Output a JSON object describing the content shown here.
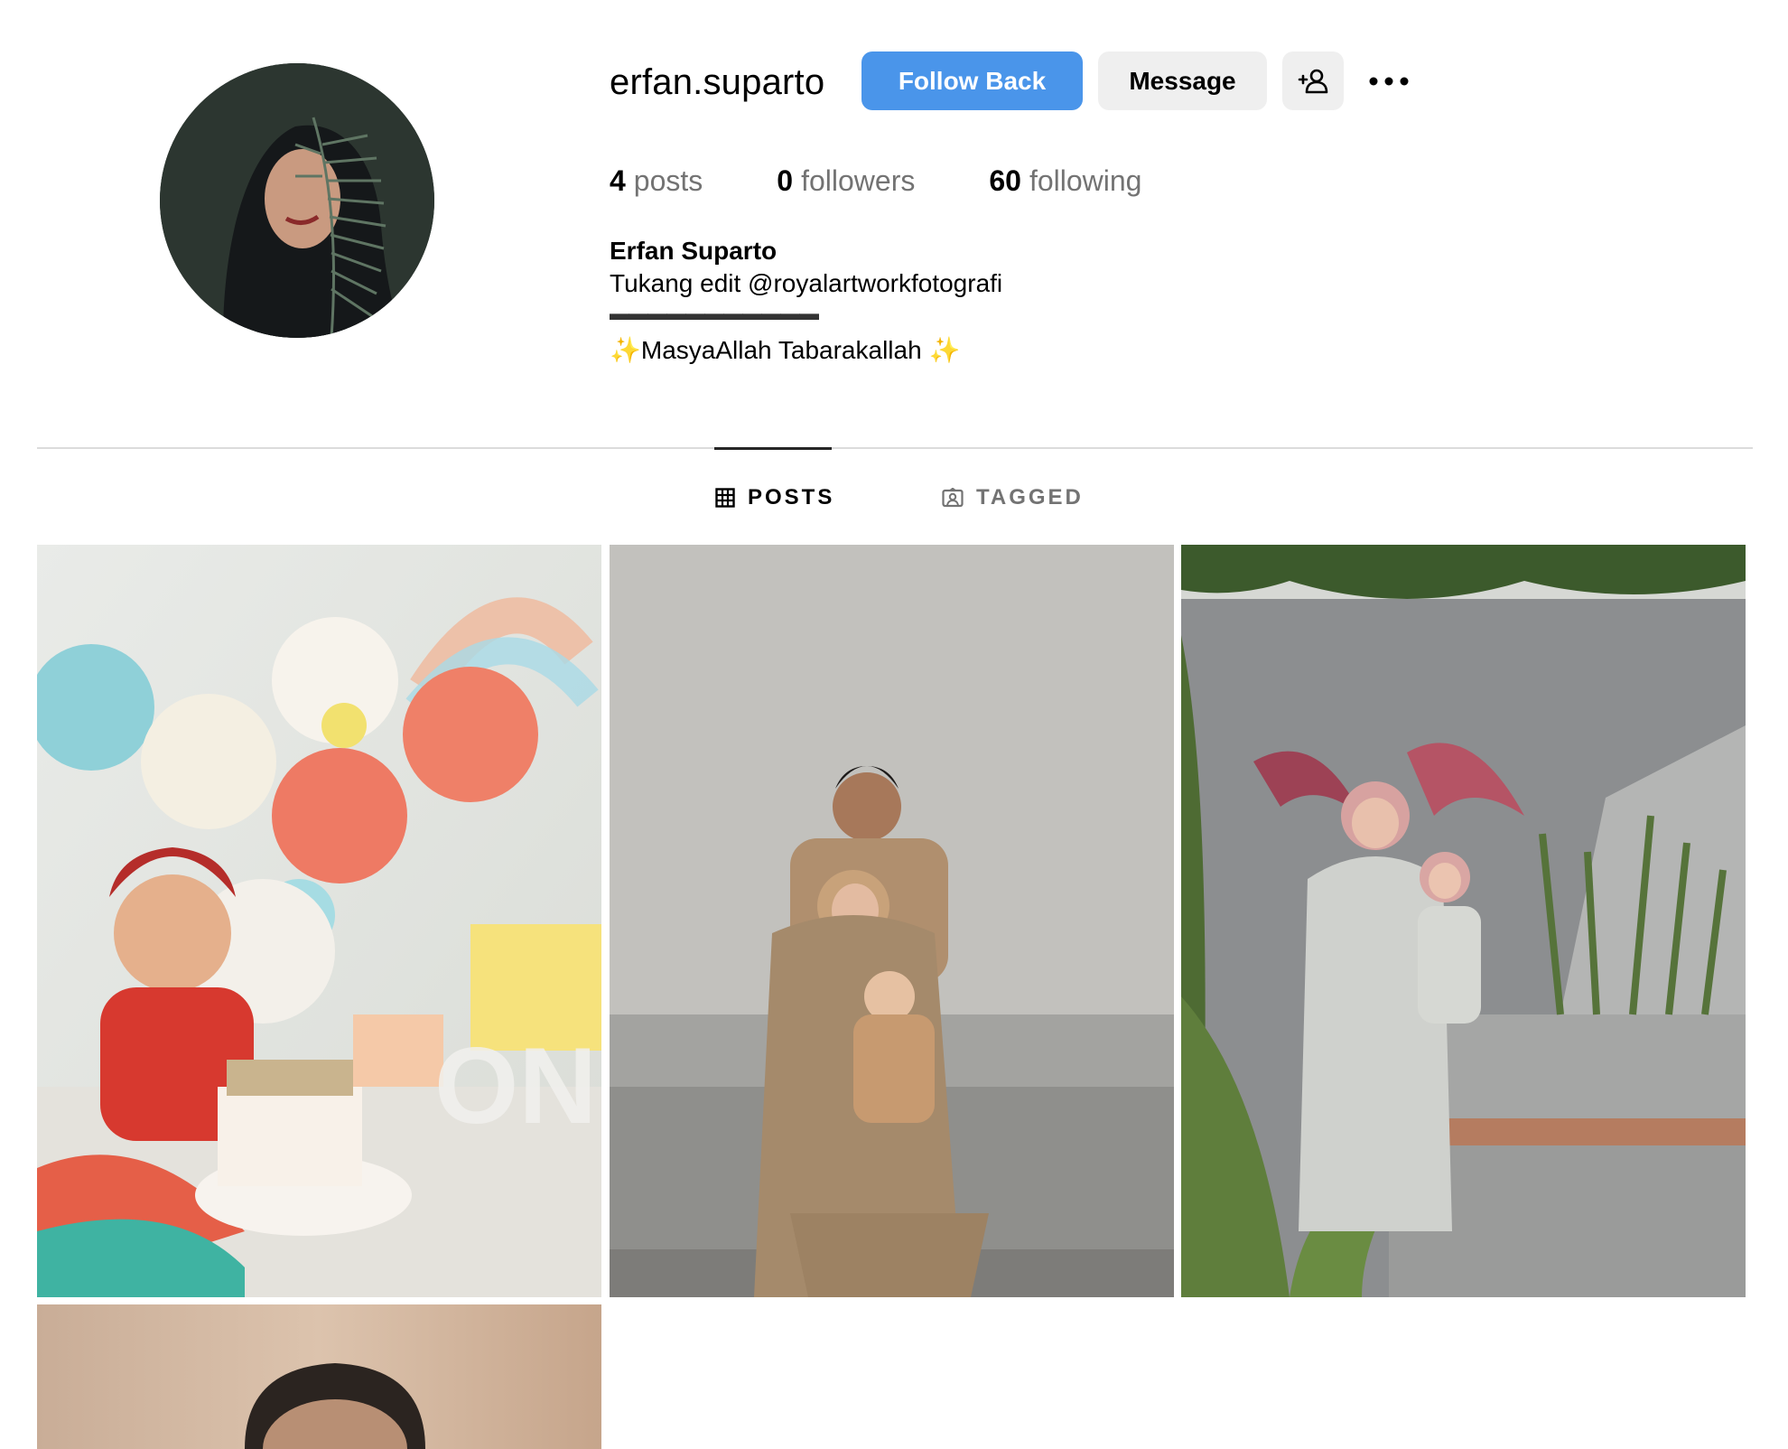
{
  "profile": {
    "username": "erfan.suparto",
    "full_name": "Erfan Suparto",
    "bio_line1": "Tukang edit @royalartworkfotografi",
    "bio_line2": "▬▬▬▬▬▬▬▬▬▬▬",
    "bio_line3_sparkle_left": "✨",
    "bio_line3_text": "MasyaAllah Tabarakallah ",
    "bio_line3_sparkle_right": "✨",
    "avatar_icon": "profile-photo"
  },
  "actions": {
    "follow_back_label": "Follow Back",
    "message_label": "Message",
    "add_user_icon": "add-person-icon",
    "more_icon": "more-options-icon"
  },
  "stats": {
    "posts_count": "4",
    "posts_label": "posts",
    "followers_count": "0",
    "followers_label": "followers",
    "following_count": "60",
    "following_label": "following"
  },
  "tabs": [
    {
      "label": "POSTS",
      "icon": "grid-icon",
      "active": true
    },
    {
      "label": "TAGGED",
      "icon": "tagged-icon",
      "active": false
    }
  ],
  "colors": {
    "primary_button": "#4a95ea",
    "secondary_button": "#efefef",
    "muted_text": "#737373",
    "divider": "#dbdbdb"
  },
  "posts": [
    {
      "description": "baby-birthday-cake-smash"
    },
    {
      "description": "family-portrait-on-sofa"
    },
    {
      "description": "mother-and-child-garden"
    },
    {
      "description": "man-portrait"
    }
  ]
}
